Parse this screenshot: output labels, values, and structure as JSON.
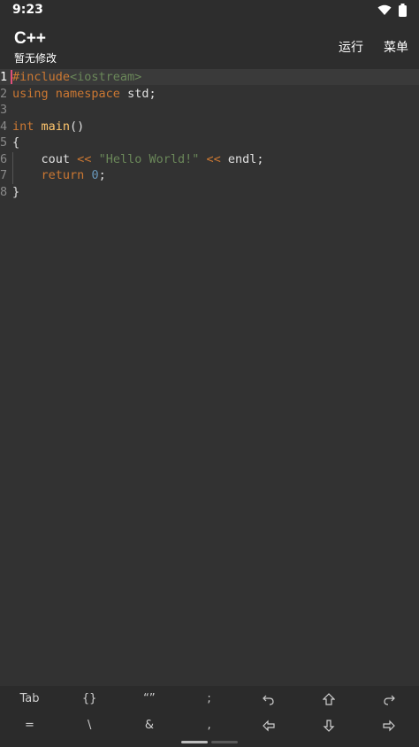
{
  "status": {
    "time": "9:23"
  },
  "app": {
    "title": "C++",
    "subtitle": "暂无修改",
    "run_label": "运行",
    "menu_label": "菜单"
  },
  "editor": {
    "lines": [
      {
        "num": "1",
        "parts": [
          [
            "kw-dir",
            "#include"
          ],
          [
            "kw-ang",
            "<iostream>"
          ]
        ]
      },
      {
        "num": "2",
        "parts": [
          [
            "kw",
            "using"
          ],
          [
            "plain",
            " "
          ],
          [
            "kw",
            "namespace"
          ],
          [
            "plain",
            " std;"
          ]
        ]
      },
      {
        "num": "3",
        "parts": []
      },
      {
        "num": "4",
        "parts": [
          [
            "kw",
            "int"
          ],
          [
            "plain",
            " "
          ],
          [
            "fn",
            "main"
          ],
          [
            "plain",
            "()"
          ]
        ]
      },
      {
        "num": "5",
        "parts": [
          [
            "plain",
            "{"
          ]
        ]
      },
      {
        "num": "6",
        "parts": [
          [
            "plain",
            "    cout "
          ],
          [
            "op",
            "<<"
          ],
          [
            "plain",
            " "
          ],
          [
            "str",
            "\"Hello World!\""
          ],
          [
            "plain",
            " "
          ],
          [
            "op",
            "<<"
          ],
          [
            "plain",
            " endl;"
          ]
        ]
      },
      {
        "num": "7",
        "parts": [
          [
            "plain",
            "    "
          ],
          [
            "kw",
            "return"
          ],
          [
            "plain",
            " "
          ],
          [
            "num",
            "0"
          ],
          [
            "plain",
            ";"
          ]
        ]
      },
      {
        "num": "8",
        "parts": [
          [
            "plain",
            "}"
          ]
        ]
      }
    ]
  },
  "keys": {
    "row1": [
      {
        "label": "Tab",
        "name": "tab-key"
      },
      {
        "label": "{}",
        "name": "braces-key"
      },
      {
        "label": "“”",
        "name": "quotes-key"
      },
      {
        "label": ";",
        "name": "semicolon-key"
      },
      {
        "icon": "undo-icon",
        "name": "undo-key"
      },
      {
        "icon": "shift-icon",
        "name": "shift-key"
      },
      {
        "icon": "redo-icon",
        "name": "redo-key"
      }
    ],
    "row2": [
      {
        "label": "=",
        "name": "equals-key"
      },
      {
        "label": "\\",
        "name": "backslash-key"
      },
      {
        "label": "&",
        "name": "ampersand-key"
      },
      {
        "label": ",",
        "name": "comma-key"
      },
      {
        "icon": "arrow-left-icon",
        "name": "left-key"
      },
      {
        "icon": "arrow-down-icon",
        "name": "down-key"
      },
      {
        "icon": "arrow-right-icon",
        "name": "right-key"
      }
    ]
  }
}
